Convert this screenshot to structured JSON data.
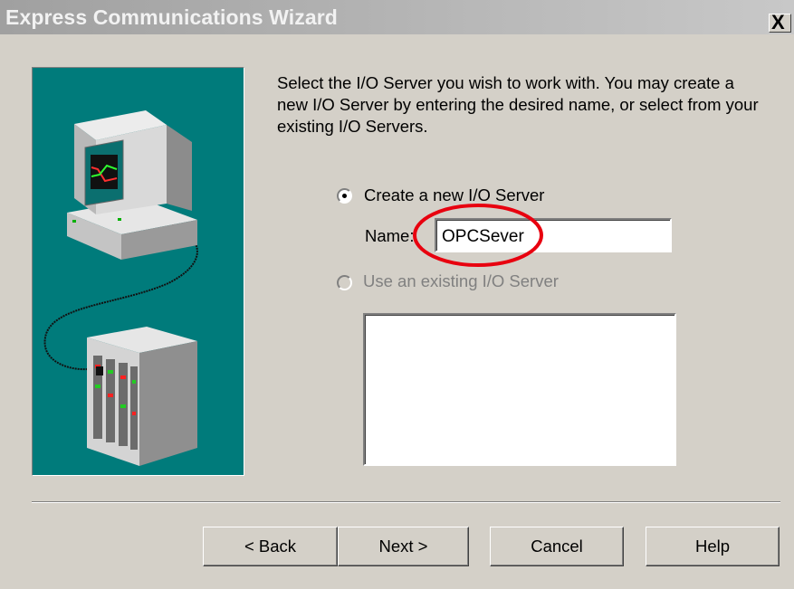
{
  "window": {
    "title": "Express Communications Wizard",
    "close_label": "X"
  },
  "instruction": "Select the I/O Server you wish to work with. You may create a new I/O Server by entering the desired name, or select from your existing I/O Servers.",
  "options": {
    "create_new": {
      "label": "Create a new I/O Server",
      "selected": true
    },
    "name_label": "Name:",
    "name_value": "OPCSever",
    "use_existing": {
      "label": "Use an existing I/O Server",
      "enabled": false
    }
  },
  "existing_servers": [],
  "buttons": {
    "back": "< Back",
    "next": "Next >",
    "cancel": "Cancel",
    "help": "Help"
  },
  "colors": {
    "dialog_bg": "#d4d0c8",
    "art_panel_bg": "#007b7b",
    "annotation": "#e8000f"
  },
  "icons": [
    "computer-monitor-icon",
    "plc-rack-icon",
    "close-icon"
  ]
}
